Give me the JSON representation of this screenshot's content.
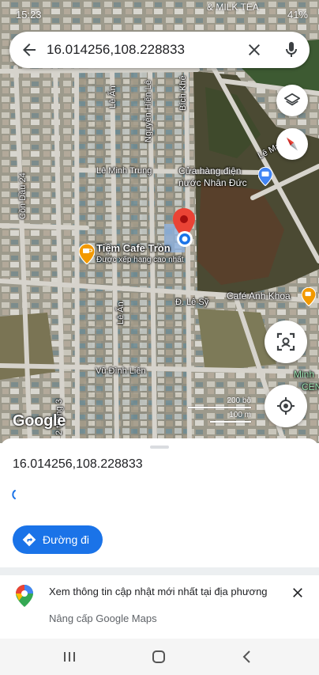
{
  "status_bar": {
    "time": "15:23",
    "battery": "41%",
    "signal_text": "& MILK TEA"
  },
  "search": {
    "query": "16.014256,108.228833"
  },
  "map": {
    "streets": {
      "le_minh_trung": "Lê Minh Trung",
      "con_dau_24": "Cồn Dầu 24",
      "le_an_top": "Lê Ấn",
      "le_an_bottom": "Lê Ấn",
      "nguyen_hien_le": "Nguyễn Hiến Lê",
      "bich_khe": "Bích Khê",
      "le_sy": "Đ. Lê Sỹ",
      "vu_dinh_lien": "Vũ Đình Liên",
      "thang_3": "2 tháng 3",
      "le_manh": "Lê Mạnh",
      "minh": "Minh",
      "cen": "CEN"
    },
    "pois": {
      "cafe_tron_name": "Tiệm Cafe Tròn",
      "cafe_tron_sub": "Được xếp hạng cao nhất",
      "cafe_anh_khoa": "Café Anh Khoa",
      "cua_hang_line1": "Cửa hàng điện",
      "cua_hang_line2": "nước Nhân Đức"
    },
    "logo": "Google",
    "scale_top": "200 bộ",
    "scale_bottom": "100 m"
  },
  "sheet": {
    "coords": "16.014256,108.228833",
    "directions_label": "Đường đi"
  },
  "promo": {
    "title": "Xem thông tin cập nhật mới nhất tại địa phương",
    "subtitle": "Nâng cấp Google Maps"
  },
  "colors": {
    "accent": "#1a73e8",
    "pin": "#ea4335",
    "cafe": "#f29900"
  }
}
